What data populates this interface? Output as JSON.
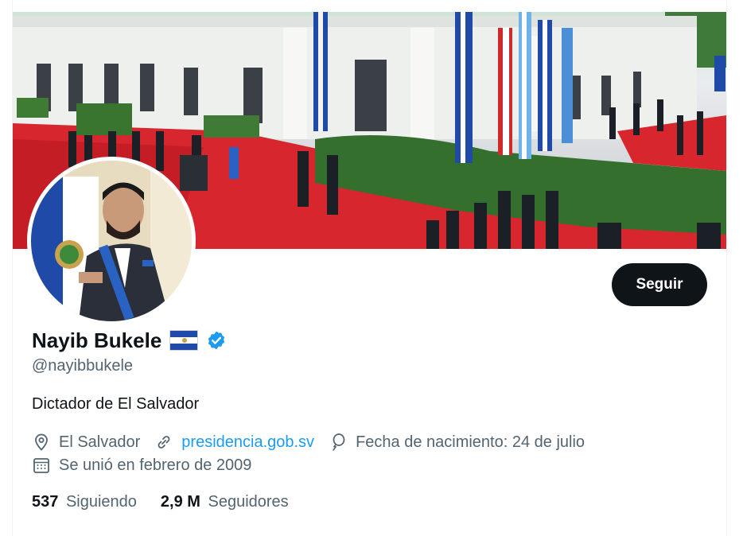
{
  "profile": {
    "name": "Nayib Bukele",
    "handle": "@nayibbukele",
    "bio": "Dictador de El Salvador",
    "location": "El Salvador",
    "website": "presidencia.gob.sv",
    "birthday": "Fecha de nacimiento: 24 de julio",
    "joined": "Se unió en febrero de 2009",
    "following_count": "537",
    "following_label": "Siguiendo",
    "followers_count": "2,9 M",
    "followers_label": "Seguidores"
  },
  "actions": {
    "follow_label": "Seguir"
  },
  "icons": {
    "location": "location-pin-icon",
    "website": "link-icon",
    "birthday": "balloon-icon",
    "joined": "calendar-icon",
    "verified": "verified-badge-icon",
    "flag": "el-salvador-flag-icon"
  },
  "colors": {
    "accent": "#1d9bf0",
    "button_bg": "#0f1419",
    "secondary_text": "#536471"
  }
}
